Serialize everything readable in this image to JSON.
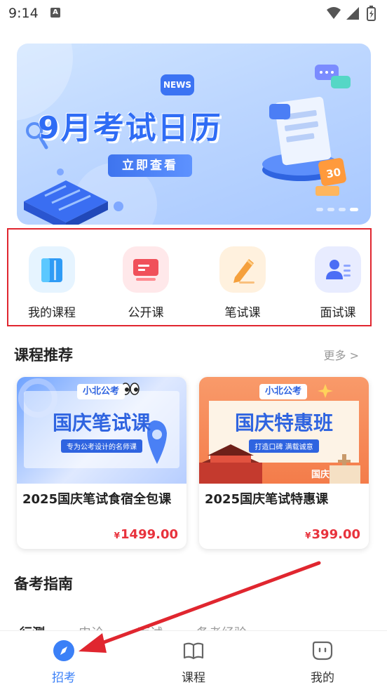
{
  "status_bar": {
    "time": "9:14",
    "notification_glyph": "A"
  },
  "banner": {
    "title": "9月考试日历",
    "news_badge": "NEWS",
    "button_label": "立即查看",
    "badge_number": "30",
    "pages": 4,
    "active_page": 3
  },
  "quick_entries": [
    {
      "label": "我的课程",
      "icon": "book-icon",
      "color": "#2f9bf5",
      "bg": "#e6f4ff"
    },
    {
      "label": "公开课",
      "icon": "screen-icon",
      "color": "#f0505a",
      "bg": "#ffe8ea"
    },
    {
      "label": "笔试课",
      "icon": "pen-icon",
      "color": "#f5a03c",
      "bg": "#fff1de"
    },
    {
      "label": "面试课",
      "icon": "interview-icon",
      "color": "#4b6df5",
      "bg": "#e8ecff"
    }
  ],
  "recommend": {
    "title": "课程推荐",
    "more_label": "更多 >",
    "courses": [
      {
        "brand": "小北公考",
        "cover_title": "国庆笔试课",
        "cover_subtitle": "专为公考设计的名师课",
        "name": "2025国庆笔试食宿全包课",
        "currency": "¥",
        "price": "1499.00"
      },
      {
        "brand": "小北公考",
        "cover_title": "国庆特惠班",
        "cover_subtitle": "打造口碑 满载诚意",
        "cover_stamp": "国庆",
        "name": "2025国庆笔试特惠课",
        "currency": "¥",
        "price": "399.00"
      }
    ]
  },
  "guide": {
    "title": "备考指南",
    "tabs": [
      "行测",
      "申论",
      "面试",
      "备考经验"
    ]
  },
  "bottom_nav": {
    "items": [
      {
        "label": "招考",
        "icon": "compass-icon",
        "active": true
      },
      {
        "label": "课程",
        "icon": "open-book-icon",
        "active": false
      },
      {
        "label": "我的",
        "icon": "profile-face-icon",
        "active": false
      }
    ]
  },
  "colors": {
    "accent": "#3b80f7",
    "price": "#e8323c",
    "annotation": "#e0262f"
  }
}
